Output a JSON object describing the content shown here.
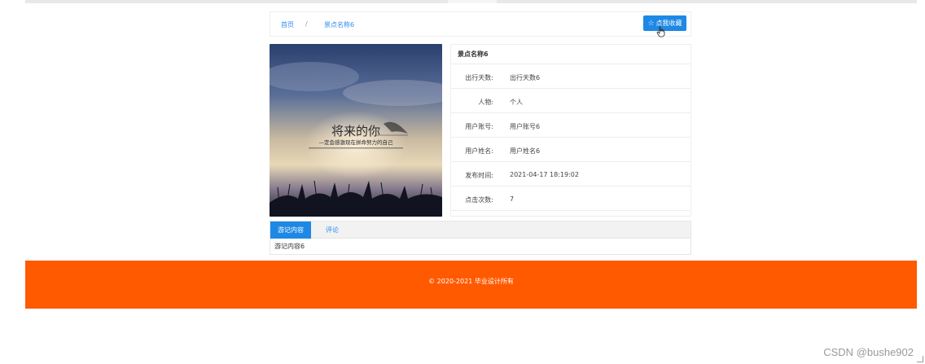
{
  "breadcrumb": {
    "home": "首页",
    "separator": "/",
    "current": "景点名称6"
  },
  "favorite_button": {
    "label": "点我收藏",
    "icon": "star-outline-icon"
  },
  "photo": {
    "title_text": "将来的你",
    "subtitle_text": "—定会感激现在拼命努力的自己"
  },
  "info": {
    "title": "景点名称6",
    "rows": [
      {
        "label": "出行天数:",
        "value": "出行天数6"
      },
      {
        "label": "人物:",
        "value": "个人"
      },
      {
        "label": "用户账号:",
        "value": "用户账号6"
      },
      {
        "label": "用户姓名:",
        "value": "用户姓名6"
      },
      {
        "label": "发布时间:",
        "value": "2021-04-17 18:19:02"
      },
      {
        "label": "点击次数:",
        "value": "7"
      }
    ]
  },
  "tabs": [
    {
      "label": "游记内容",
      "active": true
    },
    {
      "label": "评论",
      "active": false
    }
  ],
  "tab_content": "游记内容6",
  "footer": {
    "copyright": "© 2020-2021 毕业设计所有"
  },
  "watermark": "CSDN @bushe902",
  "colors": {
    "primary": "#1e88e5",
    "link": "#2d8cf0",
    "footer": "#ff5a00"
  }
}
